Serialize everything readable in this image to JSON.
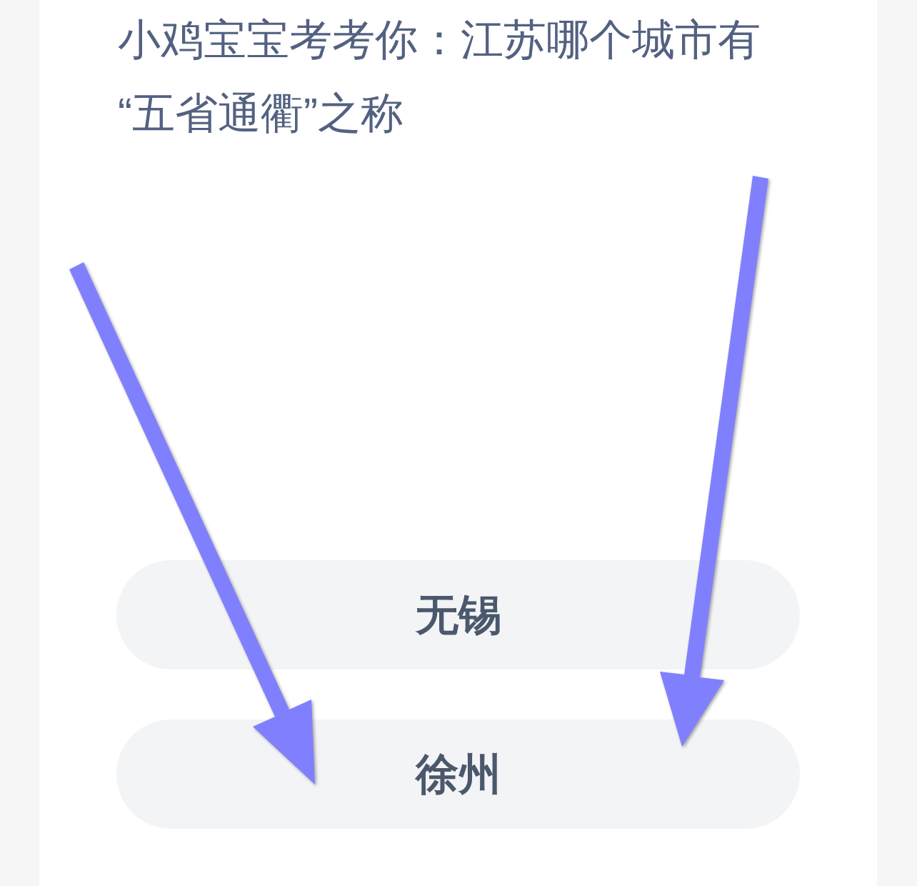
{
  "question": {
    "title": "小鸡宝宝考考你：江苏哪个城市有“五省通衢”之称"
  },
  "options": [
    {
      "label": "无锡"
    },
    {
      "label": "徐州"
    }
  ],
  "annotation_arrows": [
    {
      "kind": "arrow"
    },
    {
      "kind": "arrow"
    }
  ]
}
